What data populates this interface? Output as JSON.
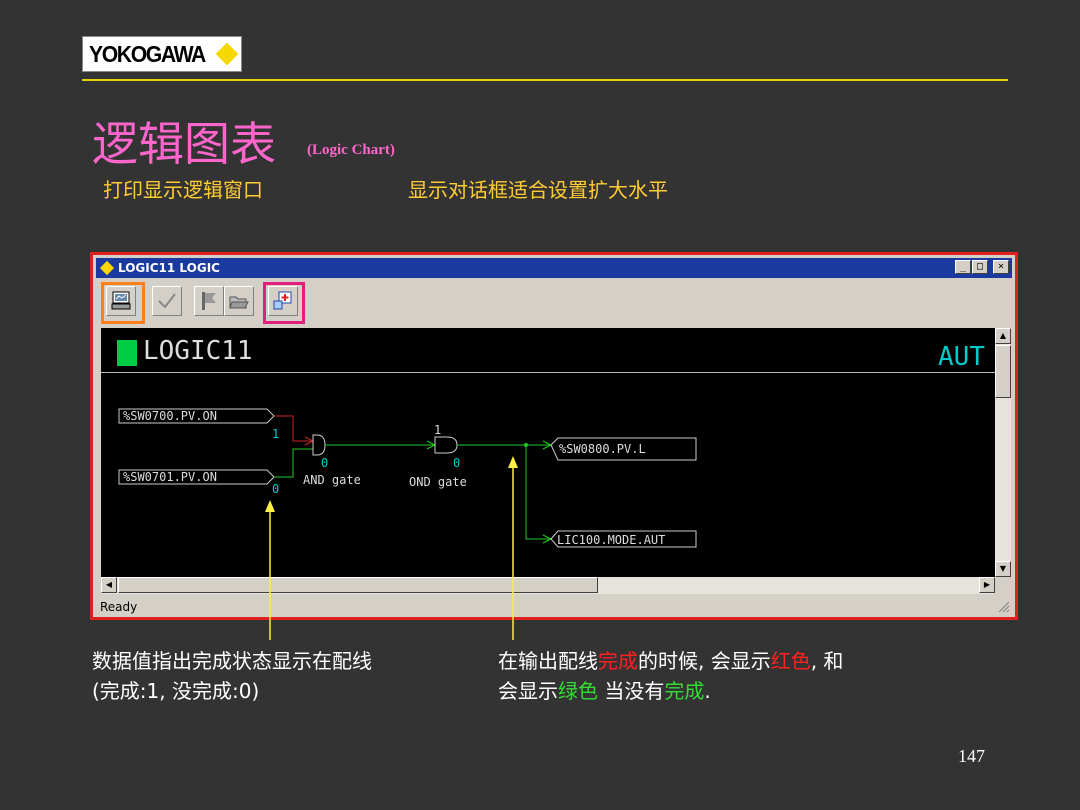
{
  "logo": {
    "text": "YOKOGAWA"
  },
  "header": {
    "title": "逻辑图表",
    "subtitle": "(Logic Chart)"
  },
  "notes": {
    "left": "打印显示逻辑窗口",
    "right": "显示对话框适合设置扩大水平"
  },
  "window": {
    "title": "LOGIC11 LOGIC",
    "controls": [
      "_",
      "□",
      "×"
    ],
    "toolbar": [
      "print-icon",
      "check-icon",
      "flag-icon",
      "folder-open-icon",
      "zoom-fit-icon"
    ],
    "logic_name": "LOGIC11",
    "mode": "AUT",
    "status": "Ready",
    "diagram": {
      "inputs": [
        {
          "tag": "%SW0700.PV.ON",
          "value": "1"
        },
        {
          "tag": "%SW0701.PV.ON",
          "value": "0"
        }
      ],
      "gates": [
        {
          "label": "AND gate",
          "out_value": "0"
        },
        {
          "label": "OND gate",
          "in_value": "1",
          "out_value": "0"
        }
      ],
      "outputs": [
        {
          "tag": "%SW0800.PV.L"
        },
        {
          "tag": "LIC100.MODE.AUT"
        }
      ],
      "colors": {
        "incomplete": "#cc2222",
        "complete": "#22cc22",
        "value": "#00cccc",
        "highlight_print": "#ff7f1a",
        "highlight_zoom": "#e0207a"
      }
    }
  },
  "callouts": {
    "left_line1": "数据值指出完成状态显示在配线",
    "left_line2": "(完成:1, 没完成:0)",
    "right_p1": "在输出配线",
    "right_red1": "完成",
    "right_p2": "的时候, 会显示",
    "right_red2": "红色",
    "right_p3": ", 和",
    "right_p4": "会显示",
    "right_green1": "绿色",
    "right_p5": " 当没有",
    "right_green2": "完成",
    "right_p6": "."
  },
  "page_number": "147"
}
